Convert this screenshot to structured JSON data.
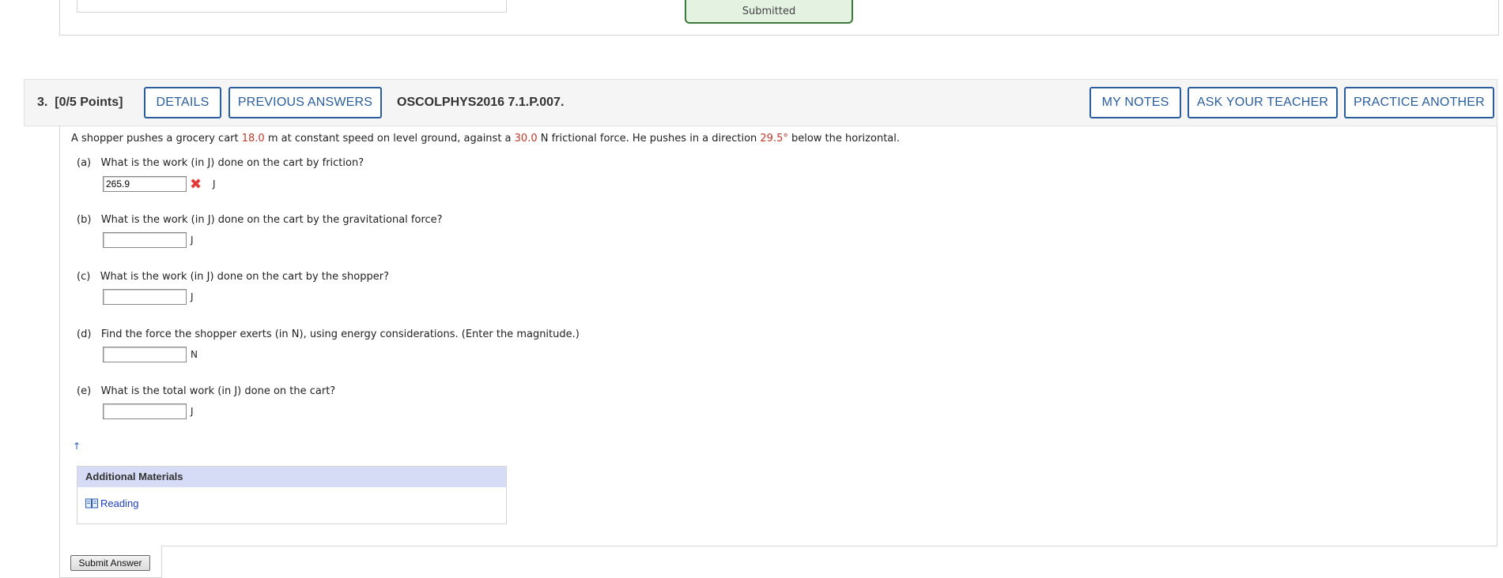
{
  "previous": {
    "status": "Submitted"
  },
  "question": {
    "number": "3.",
    "points": "[0/5 Points]",
    "buttons": {
      "details": "DETAILS",
      "previous_answers": "PREVIOUS ANSWERS",
      "my_notes": "MY NOTES",
      "ask_teacher": "ASK YOUR TEACHER",
      "practice_another": "PRACTICE ANOTHER"
    },
    "code": "OSCOLPHYS2016 7.1.P.007.",
    "prompt": {
      "t1": "A shopper pushes a grocery cart ",
      "distance": "18.0",
      "t2": " m at constant speed on level ground, against a ",
      "force": "30.0",
      "t3": " N frictional force. He pushes in a direction ",
      "angle": "29.5°",
      "t4": " below the horizontal."
    },
    "parts": [
      {
        "label": "(a)",
        "text": "What is the work (in J) done on the cart by friction?",
        "value": "265.9",
        "unit": "J",
        "status": "incorrect"
      },
      {
        "label": "(b)",
        "text": "What is the work (in J) done on the cart by the gravitational force?",
        "value": "",
        "unit": "J"
      },
      {
        "label": "(c)",
        "text": "What is the work (in J) done on the cart by the shopper?",
        "value": "",
        "unit": "J"
      },
      {
        "label": "(d)",
        "text": "Find the force the shopper exerts (in N), using energy considerations. (Enter the magnitude.)",
        "value": "",
        "unit": "N"
      },
      {
        "label": "(e)",
        "text": "What is the total work (in J) done on the cart?",
        "value": "",
        "unit": "J"
      }
    ],
    "additional_materials": {
      "title": "Additional Materials",
      "reading": "Reading"
    },
    "submit_label": "Submit Answer"
  },
  "colors": {
    "accent": "#2a5d9c",
    "highlight": "#c0392b",
    "incorrect": "#e23b3b",
    "submitted_bg": "#e3f2e1"
  }
}
